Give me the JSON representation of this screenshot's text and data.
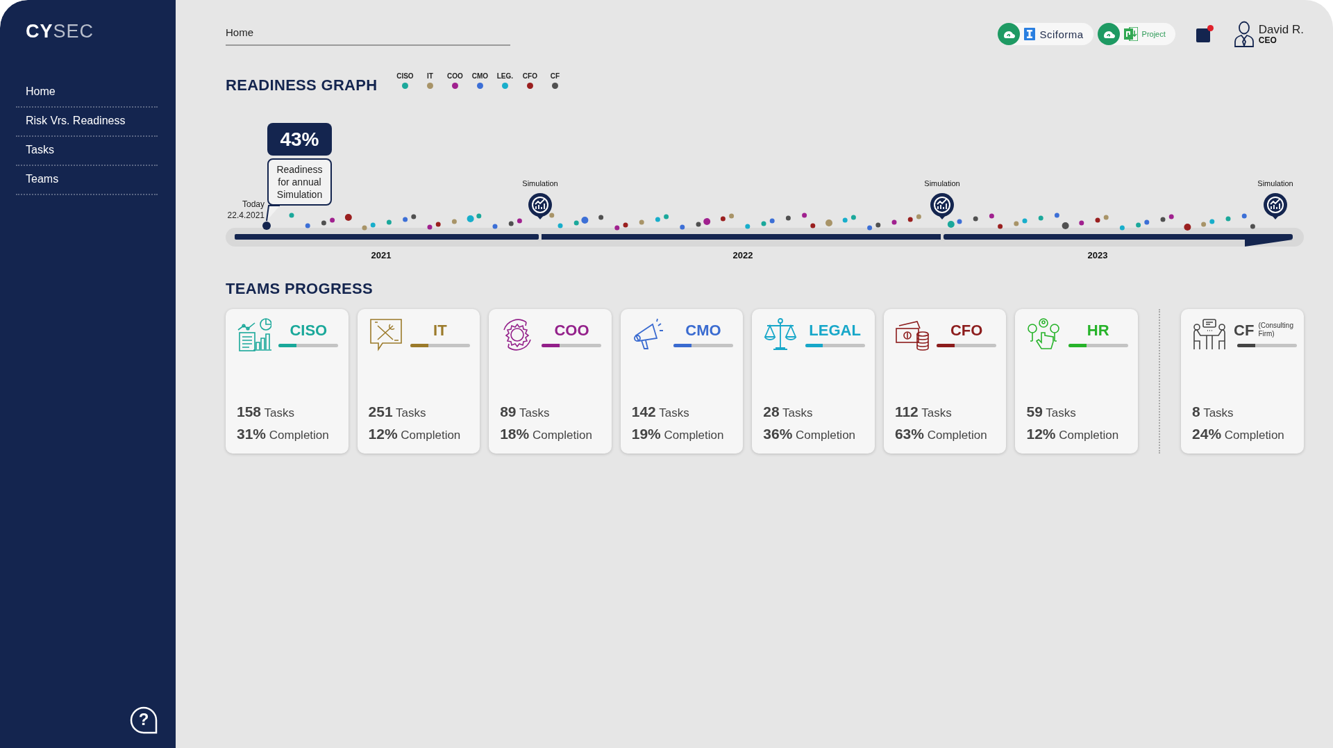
{
  "sidebar": {
    "logo": "**CY**SEC",
    "items": [
      {
        "label": "Home",
        "selected": false
      },
      {
        "label": "Risk Vrs. Readiness",
        "selected": false
      },
      {
        "label": "Tasks",
        "selected": false
      },
      {
        "label": "Teams",
        "selected": false
      }
    ],
    "help": "?"
  },
  "header": {
    "breadcrumb": "Home",
    "integrations": [
      {
        "kind": "sciforma",
        "label": "Sciforma"
      },
      {
        "kind": "project",
        "label": "Project"
      }
    ],
    "notification": {
      "unread": true
    },
    "user": {
      "name": "David R.",
      "role": "CEO"
    }
  },
  "readiness": {
    "title": "READINESS GRAPH",
    "legend": [
      {
        "label": "CISO",
        "color": "#1ba89b"
      },
      {
        "label": "IT",
        "color": "#a89468"
      },
      {
        "label": "COO",
        "color": "#a0218f"
      },
      {
        "label": "CMO",
        "color": "#3c6fd6"
      },
      {
        "label": "LEG.",
        "color": "#18aecb"
      },
      {
        "label": "CFO",
        "color": "#9a1f1f"
      },
      {
        "label": "CF",
        "color": "#505050"
      }
    ],
    "today_label": "Today",
    "today_date": "22.4.2021",
    "value": "43%",
    "caption": "Readiness for annual Simulation",
    "simulations": [
      "Simulation",
      "Simulation",
      "Simulation"
    ],
    "years": [
      "2021",
      "2022",
      "2023"
    ]
  },
  "teams_progress": {
    "title": "TEAMS PROGRESS",
    "teams": [
      {
        "kind": "team",
        "name": "CISO",
        "color": "#1aa89a",
        "level": 0.3,
        "tasks": "**158** Tasks",
        "completion": "**31%** Completion"
      },
      {
        "kind": "team",
        "name": "IT",
        "color": "#9b7a2a",
        "level": 0.3,
        "tasks": "**251** Tasks",
        "completion": "**12%** Completion"
      },
      {
        "kind": "team",
        "name": "COO",
        "color": "#93208a",
        "level": 0.3,
        "tasks": "**89** Tasks",
        "completion": "**18%** Completion"
      },
      {
        "kind": "team",
        "name": "CMO",
        "color": "#3a6bd0",
        "level": 0.3,
        "tasks": "**142** Tasks",
        "completion": "**19%** Completion"
      },
      {
        "kind": "team",
        "name": "LEGAL",
        "color": "#17a7c9",
        "level": 0.3,
        "tasks": "**28** Tasks",
        "completion": "**36%** Completion"
      },
      {
        "kind": "team",
        "name": "CFO",
        "color": "#8c1c1c",
        "level": 0.3,
        "tasks": "**112** Tasks",
        "completion": "**63%** Completion"
      },
      {
        "kind": "team",
        "name": "HR",
        "color": "#27b32a",
        "level": 0.3,
        "tasks": "**59** Tasks",
        "completion": "**12%** Completion"
      },
      {
        "kind": "external",
        "name": "CF",
        "subtitle": "(Consulting Firm)",
        "color": "#444444",
        "level": 0.3,
        "tasks": "**8** Tasks",
        "completion": "**24%** Completion"
      }
    ]
  }
}
